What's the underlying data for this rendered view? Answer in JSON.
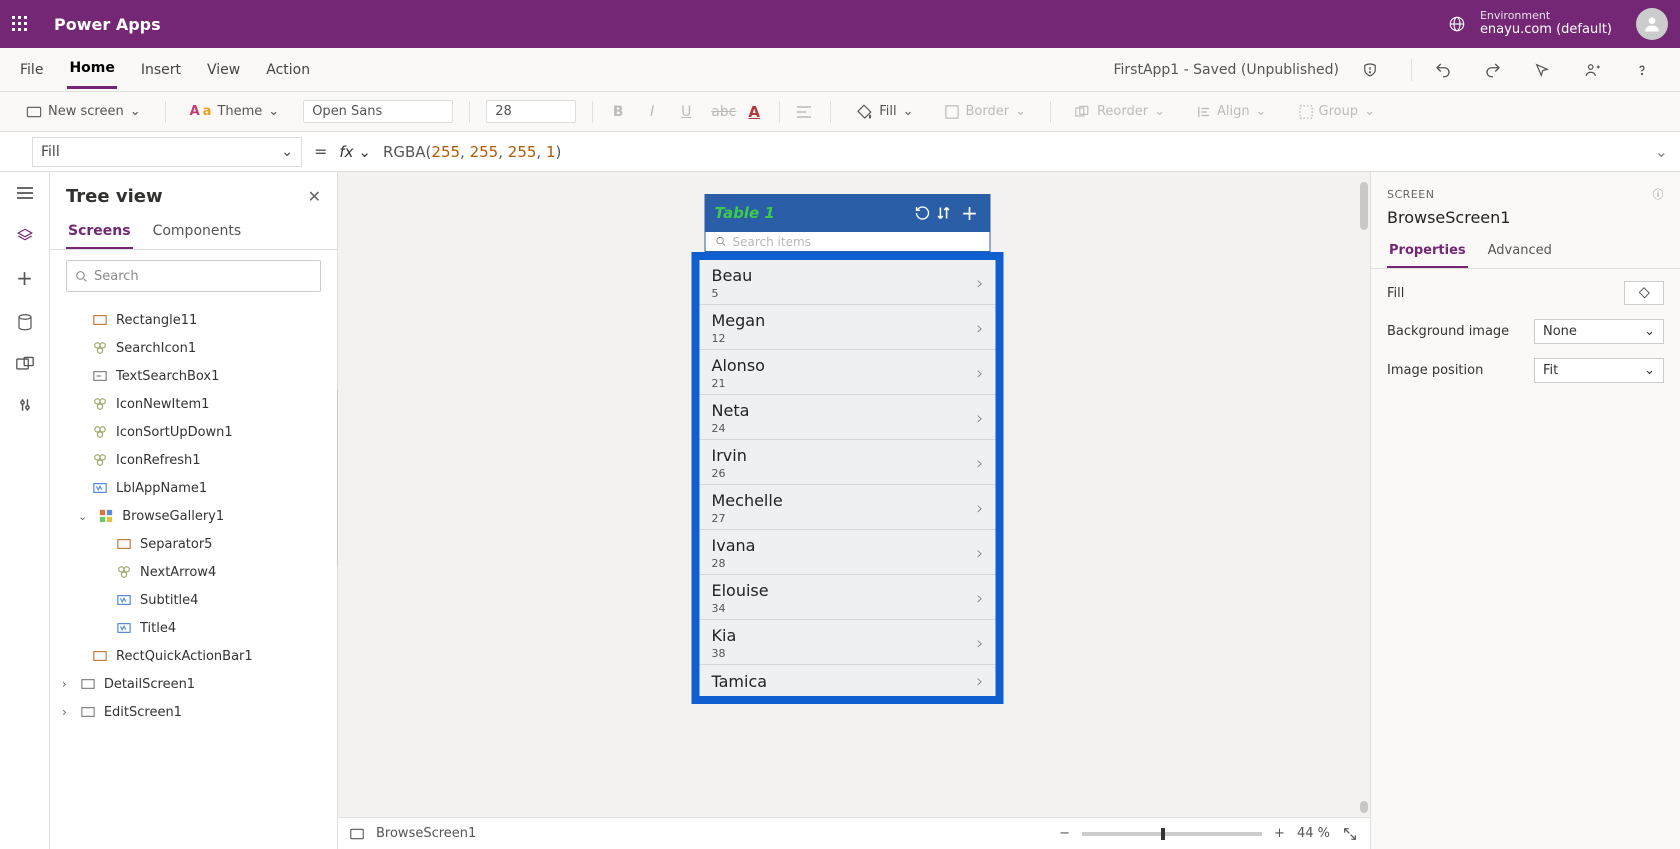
{
  "app": {
    "title": "Power Apps",
    "env_label": "Environment",
    "env_value": "enayu.com (default)"
  },
  "menu": {
    "items": [
      "File",
      "Home",
      "Insert",
      "View",
      "Action"
    ],
    "active": "Home",
    "doc_status": "FirstApp1 - Saved (Unpublished)"
  },
  "toolbar": {
    "new_screen": "New screen",
    "theme": "Theme",
    "font_family": "Open Sans",
    "font_size": "28",
    "fill": "Fill",
    "border": "Border",
    "reorder": "Reorder",
    "align": "Align",
    "group": "Group"
  },
  "formula": {
    "property": "Fill",
    "fx": "fx",
    "call": "RGBA",
    "args": [
      "255",
      "255",
      "255",
      "1"
    ]
  },
  "tree": {
    "title": "Tree view",
    "tabs": [
      "Screens",
      "Components"
    ],
    "active_tab": "Screens",
    "search_placeholder": "Search",
    "items": [
      {
        "label": "Rectangle11",
        "indent": 1,
        "icon": "rect"
      },
      {
        "label": "SearchIcon1",
        "indent": 1,
        "icon": "grp"
      },
      {
        "label": "TextSearchBox1",
        "indent": 1,
        "icon": "txt"
      },
      {
        "label": "IconNewItem1",
        "indent": 1,
        "icon": "grp"
      },
      {
        "label": "IconSortUpDown1",
        "indent": 1,
        "icon": "grp"
      },
      {
        "label": "IconRefresh1",
        "indent": 1,
        "icon": "grp"
      },
      {
        "label": "LblAppName1",
        "indent": 1,
        "icon": "lbl"
      },
      {
        "label": "BrowseGallery1",
        "indent": 1,
        "icon": "gal",
        "exp": true
      },
      {
        "label": "Separator5",
        "indent": 2,
        "icon": "rect"
      },
      {
        "label": "NextArrow4",
        "indent": 2,
        "icon": "grp"
      },
      {
        "label": "Subtitle4",
        "indent": 2,
        "icon": "lbl"
      },
      {
        "label": "Title4",
        "indent": 2,
        "icon": "lbl"
      },
      {
        "label": "RectQuickActionBar1",
        "indent": 1,
        "icon": "rect"
      },
      {
        "label": "DetailScreen1",
        "indent": 0,
        "icon": "scr",
        "coll": true
      },
      {
        "label": "EditScreen1",
        "indent": 0,
        "icon": "scr",
        "coll": true
      }
    ]
  },
  "phone": {
    "header_title": "Table 1",
    "search_placeholder": "Search items",
    "rows": [
      {
        "name": "Beau",
        "sub": "5"
      },
      {
        "name": "Megan",
        "sub": "12"
      },
      {
        "name": "Alonso",
        "sub": "21"
      },
      {
        "name": "Neta",
        "sub": "24"
      },
      {
        "name": "Irvin",
        "sub": "26"
      },
      {
        "name": "Mechelle",
        "sub": "27"
      },
      {
        "name": "Ivana",
        "sub": "28"
      },
      {
        "name": "Elouise",
        "sub": "34"
      },
      {
        "name": "Kia",
        "sub": "38"
      },
      {
        "name": "Tamica",
        "sub": ""
      }
    ]
  },
  "props": {
    "section": "SCREEN",
    "title": "BrowseScreen1",
    "tabs": [
      "Properties",
      "Advanced"
    ],
    "active_tab": "Properties",
    "rows": {
      "fill_label": "Fill",
      "bg_label": "Background image",
      "bg_value": "None",
      "imgpos_label": "Image position",
      "imgpos_value": "Fit"
    }
  },
  "status": {
    "selected": "BrowseScreen1",
    "zoom_minus": "−",
    "zoom_plus": "+",
    "zoom_pct": "44",
    "zoom_unit": "%"
  }
}
